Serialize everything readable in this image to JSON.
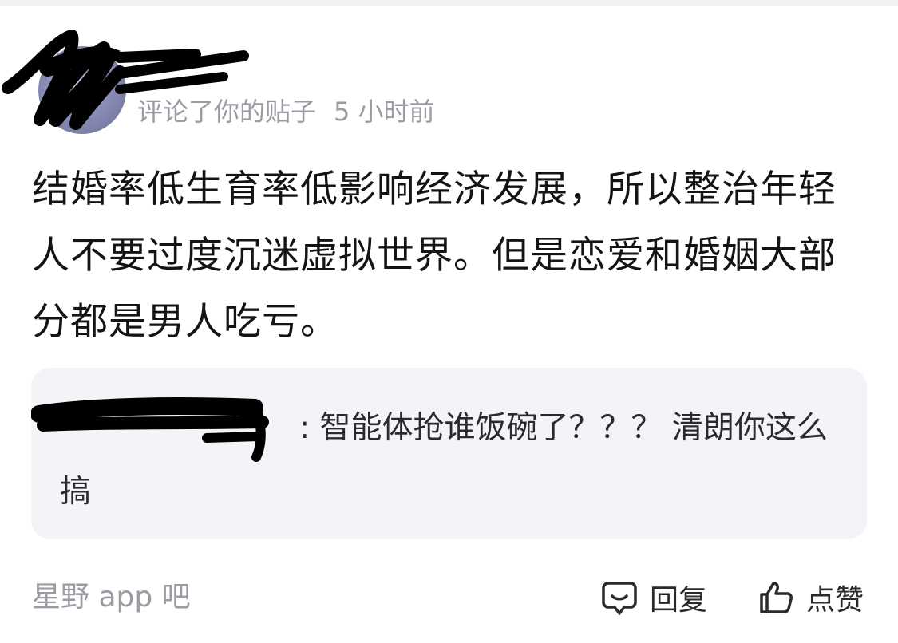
{
  "header": {
    "action_text": "评论了你的贴子",
    "time": "5 小时前"
  },
  "post": {
    "content": "结婚率低生育率低影响经济发展，所以整治年轻人不要过度沉迷虚拟世界。但是恋爱和婚姻大部分都是男人吃亏。"
  },
  "quote": {
    "text": ": 智能体抢谁饭碗了？？？ 清朗你这么搞"
  },
  "footer": {
    "source": "星野 app 吧",
    "reply_label": "回复",
    "like_label": "点赞"
  },
  "icons": {
    "reply": "chat-bubble-icon",
    "like": "thumbs-up-icon"
  }
}
